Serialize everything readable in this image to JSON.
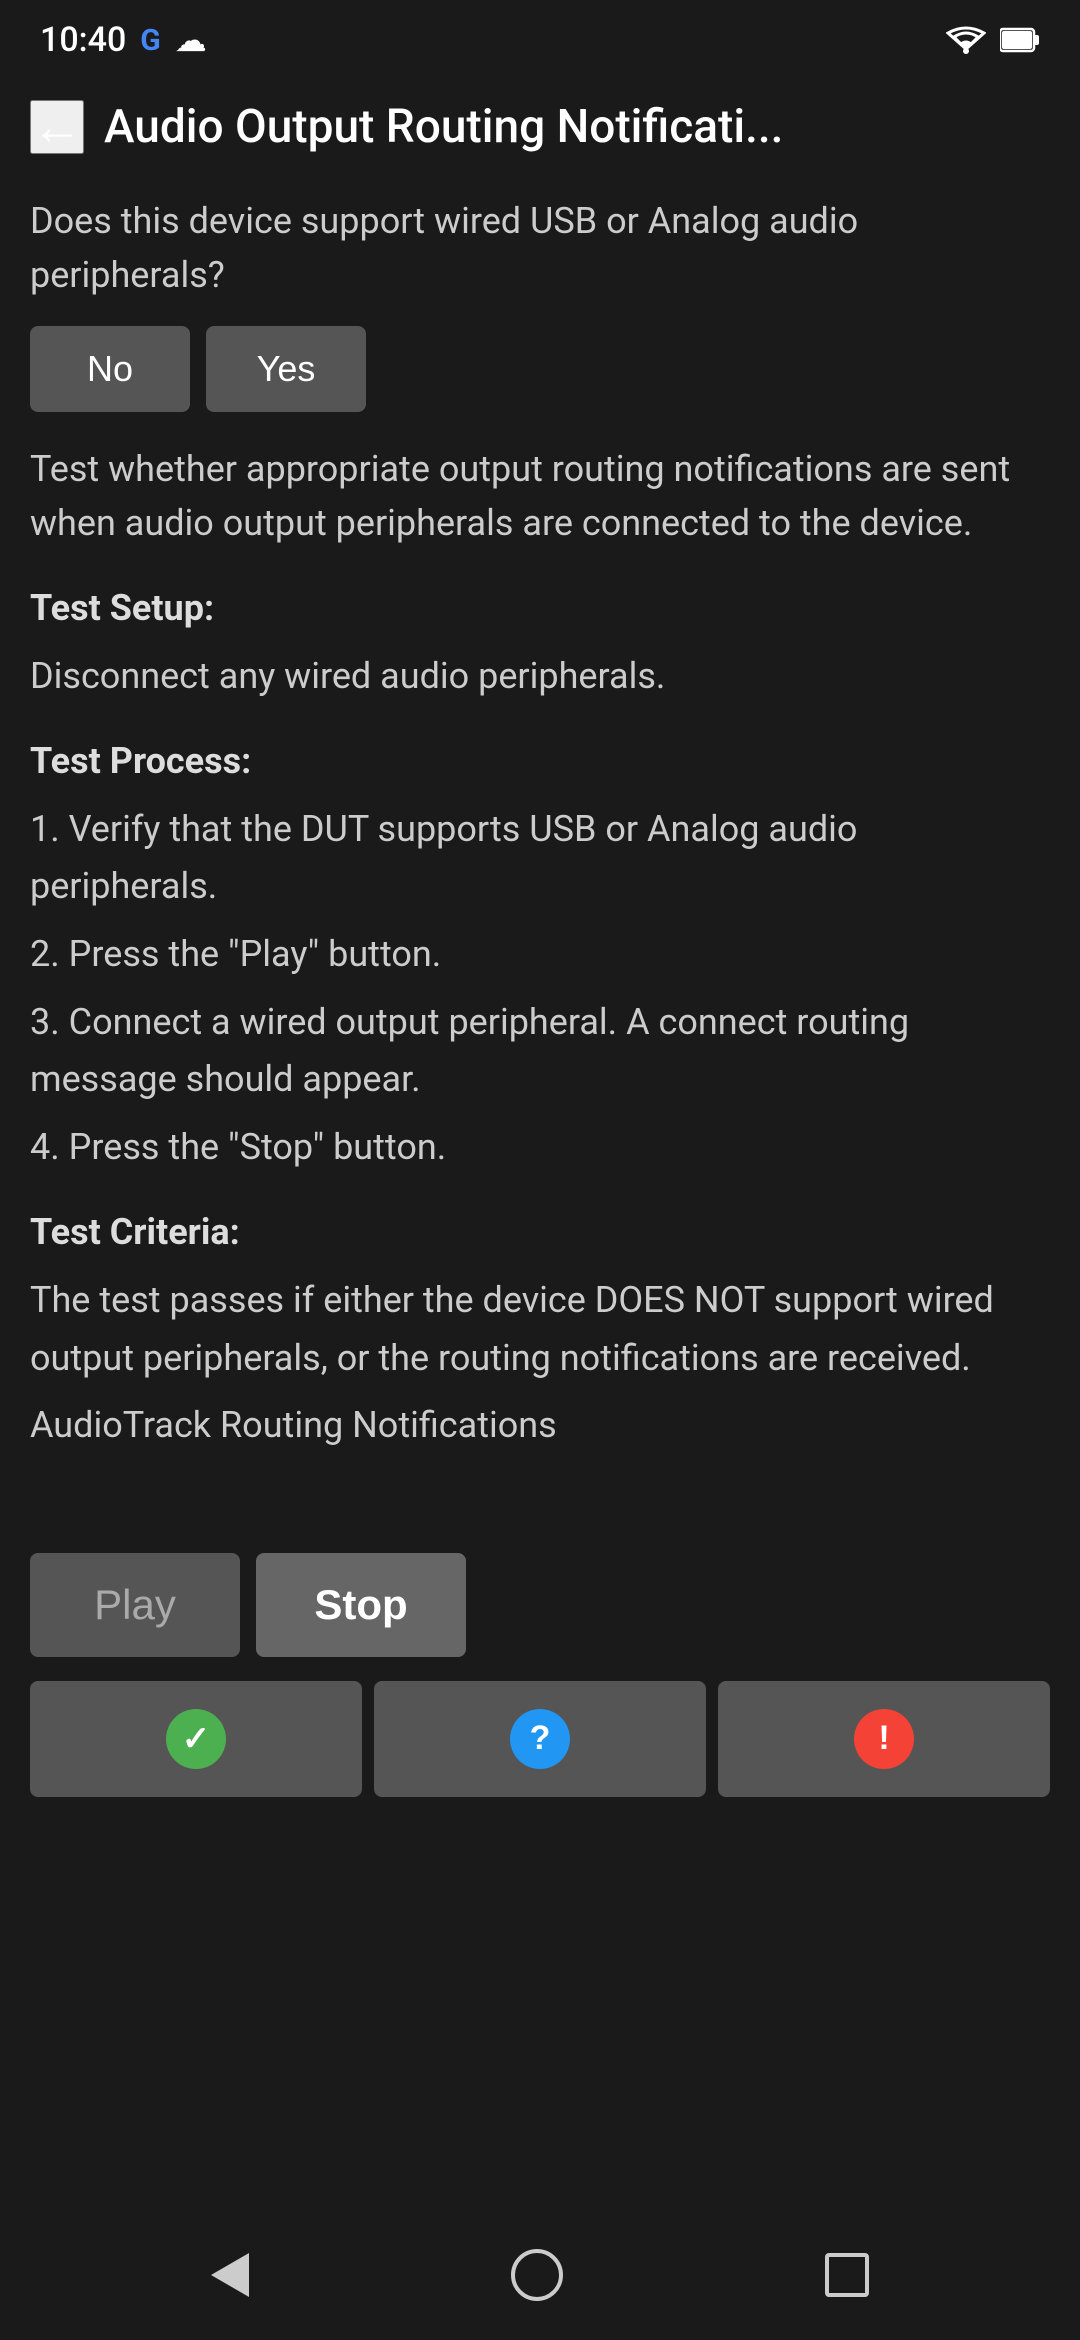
{
  "statusBar": {
    "time": "10:40",
    "googleLabel": "G",
    "cloudLabel": "☁"
  },
  "header": {
    "backLabel": "←",
    "title": "Audio Output Routing Notificati..."
  },
  "main": {
    "question": "Does this device support wired USB or Analog audio peripherals?",
    "noLabel": "No",
    "yesLabel": "Yes",
    "description": "Test whether appropriate output routing notifications are sent when audio output peripherals are connected to the device.",
    "testSetup": {
      "label": "Test Setup:",
      "content": "Disconnect any wired audio peripherals."
    },
    "testProcess": {
      "label": "Test Process:",
      "steps": [
        "1. Verify that the DUT supports USB or Analog audio peripherals.",
        "2. Press the \"Play\" button.",
        "3. Connect a wired output peripheral. A connect routing message should appear.",
        "4. Press the \"Stop\" button."
      ]
    },
    "testCriteria": {
      "label": "Test Criteria:",
      "content": "The test passes if either the device DOES NOT support wired output peripherals, or the routing notifications are received.",
      "subContent": "AudioTrack Routing Notifications"
    }
  },
  "controls": {
    "playLabel": "Play",
    "stopLabel": "Stop"
  },
  "resultButtons": {
    "pass": "✓",
    "info": "?",
    "fail": "!"
  },
  "navBar": {
    "backLabel": "back",
    "homeLabel": "home",
    "recentsLabel": "recents"
  }
}
